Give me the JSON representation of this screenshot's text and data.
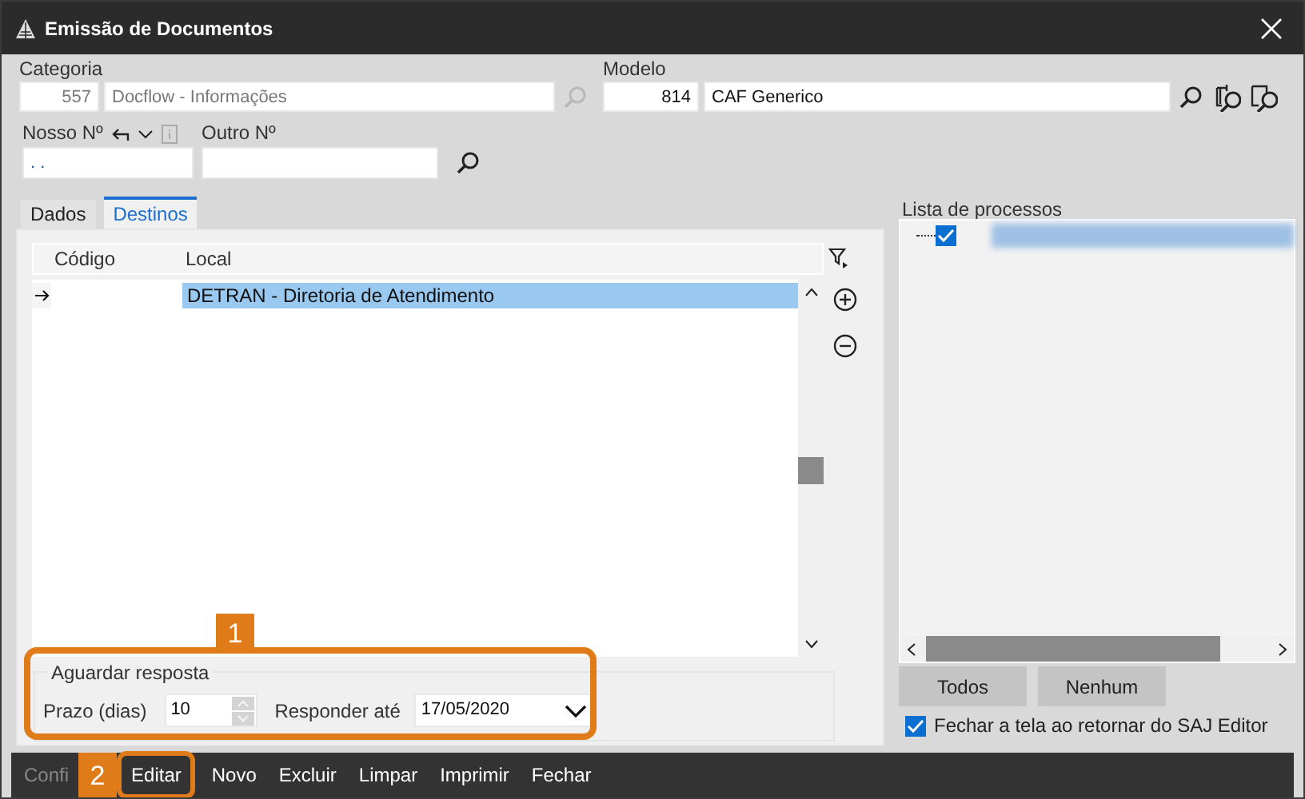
{
  "window": {
    "title": "Emissão de Documentos"
  },
  "categoria": {
    "label": "Categoria",
    "code": "557",
    "name": "Docflow - Informações",
    "disabled": true
  },
  "modelo": {
    "label": "Modelo",
    "code": "814",
    "name": "CAF Generico"
  },
  "nosso_numero": {
    "label": "Nosso Nº",
    "value": ". ."
  },
  "outro_numero": {
    "label": "Outro Nº"
  },
  "tabs": [
    {
      "label": "Dados",
      "selected": false
    },
    {
      "label": "Destinos",
      "selected": true
    }
  ],
  "table": {
    "columns": [
      "Código",
      "Local"
    ],
    "rows": [
      {
        "current": true,
        "codigo": "",
        "local": "DETRAN - Diretoria de Atendimento",
        "selected": true
      }
    ]
  },
  "aguardar": {
    "title": "Aguardar resposta",
    "prazo_label": "Prazo (dias)",
    "prazo": "10",
    "responder_label": "Responder até",
    "responder": "17/05/2020"
  },
  "processos": {
    "title": "Lista de processos",
    "items": [
      {
        "checked": true
      }
    ]
  },
  "buttons_right": [
    "Todos",
    "Nenhum"
  ],
  "fechar_check": {
    "label": "Fechar a tela ao retornar do SAJ Editor",
    "checked": true
  },
  "toolbar": [
    {
      "label": "Confi",
      "disabled": true
    },
    {
      "label": "Editar",
      "disabled": false,
      "callout": "2"
    },
    {
      "label": "Novo",
      "disabled": false
    },
    {
      "label": "Excluir",
      "disabled": false
    },
    {
      "label": "Limpar",
      "disabled": false
    },
    {
      "label": "Imprimir",
      "disabled": false
    },
    {
      "label": "Fechar",
      "disabled": false
    }
  ],
  "callouts": [
    {
      "label": "1"
    }
  ]
}
